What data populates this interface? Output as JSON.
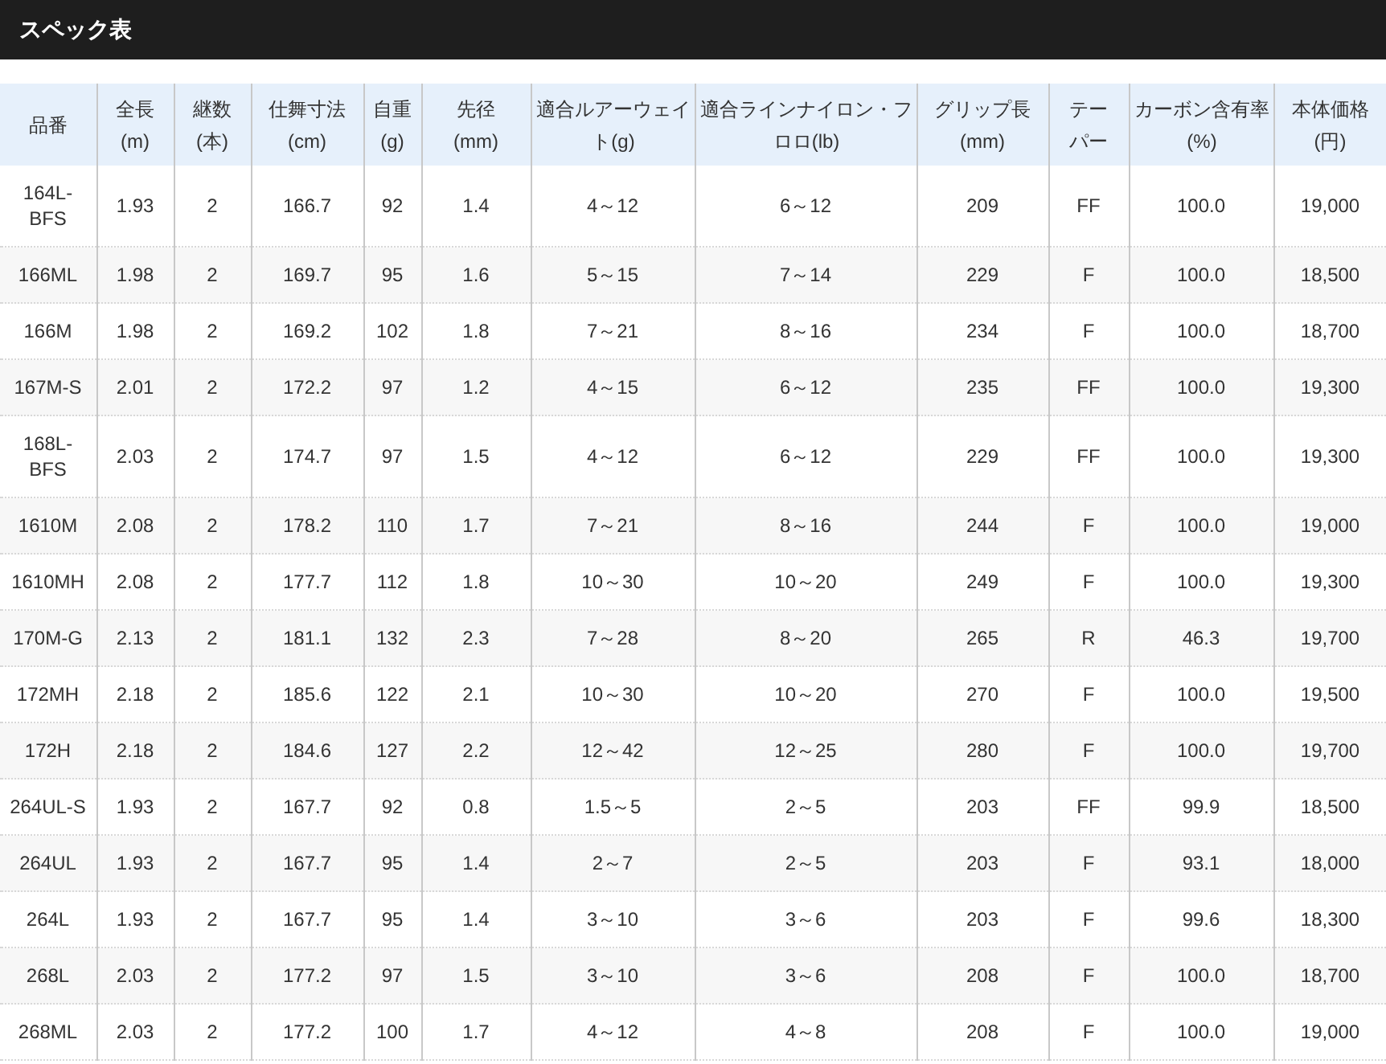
{
  "title": "スペック表",
  "table": {
    "columns": [
      "品番",
      "全長(m)",
      "継数(本)",
      "仕舞寸法(cm)",
      "自重(g)",
      "先径(mm)",
      "適合ルアーウェイト(g)",
      "適合ラインナイロン・フロロ(lb)",
      "グリップ長(mm)",
      "テーパー",
      "カーボン含有率(%)",
      "本体価格(円)"
    ],
    "rows": [
      [
        "164L-BFS",
        "1.93",
        "2",
        "166.7",
        "92",
        "1.4",
        "4～12",
        "6～12",
        "209",
        "FF",
        "100.0",
        "19,000"
      ],
      [
        "166ML",
        "1.98",
        "2",
        "169.7",
        "95",
        "1.6",
        "5～15",
        "7～14",
        "229",
        "F",
        "100.0",
        "18,500"
      ],
      [
        "166M",
        "1.98",
        "2",
        "169.2",
        "102",
        "1.8",
        "7～21",
        "8～16",
        "234",
        "F",
        "100.0",
        "18,700"
      ],
      [
        "167M-S",
        "2.01",
        "2",
        "172.2",
        "97",
        "1.2",
        "4～15",
        "6～12",
        "235",
        "FF",
        "100.0",
        "19,300"
      ],
      [
        "168L-BFS",
        "2.03",
        "2",
        "174.7",
        "97",
        "1.5",
        "4～12",
        "6～12",
        "229",
        "FF",
        "100.0",
        "19,300"
      ],
      [
        "1610M",
        "2.08",
        "2",
        "178.2",
        "110",
        "1.7",
        "7～21",
        "8～16",
        "244",
        "F",
        "100.0",
        "19,000"
      ],
      [
        "1610MH",
        "2.08",
        "2",
        "177.7",
        "112",
        "1.8",
        "10～30",
        "10～20",
        "249",
        "F",
        "100.0",
        "19,300"
      ],
      [
        "170M-G",
        "2.13",
        "2",
        "181.1",
        "132",
        "2.3",
        "7～28",
        "8～20",
        "265",
        "R",
        "46.3",
        "19,700"
      ],
      [
        "172MH",
        "2.18",
        "2",
        "185.6",
        "122",
        "2.1",
        "10～30",
        "10～20",
        "270",
        "F",
        "100.0",
        "19,500"
      ],
      [
        "172H",
        "2.18",
        "2",
        "184.6",
        "127",
        "2.2",
        "12～42",
        "12～25",
        "280",
        "F",
        "100.0",
        "19,700"
      ],
      [
        "264UL-S",
        "1.93",
        "2",
        "167.7",
        "92",
        "0.8",
        "1.5～5",
        "2～5",
        "203",
        "FF",
        "99.9",
        "18,500"
      ],
      [
        "264UL",
        "1.93",
        "2",
        "167.7",
        "95",
        "1.4",
        "2～7",
        "2～5",
        "203",
        "F",
        "93.1",
        "18,000"
      ],
      [
        "264L",
        "1.93",
        "2",
        "167.7",
        "95",
        "1.4",
        "3～10",
        "3～6",
        "203",
        "F",
        "99.6",
        "18,300"
      ],
      [
        "268L",
        "2.03",
        "2",
        "177.2",
        "97",
        "1.5",
        "3～10",
        "3～6",
        "208",
        "F",
        "100.0",
        "18,700"
      ],
      [
        "268ML",
        "2.03",
        "2",
        "177.2",
        "100",
        "1.7",
        "4～12",
        "4～8",
        "208",
        "F",
        "100.0",
        "19,000"
      ]
    ]
  }
}
